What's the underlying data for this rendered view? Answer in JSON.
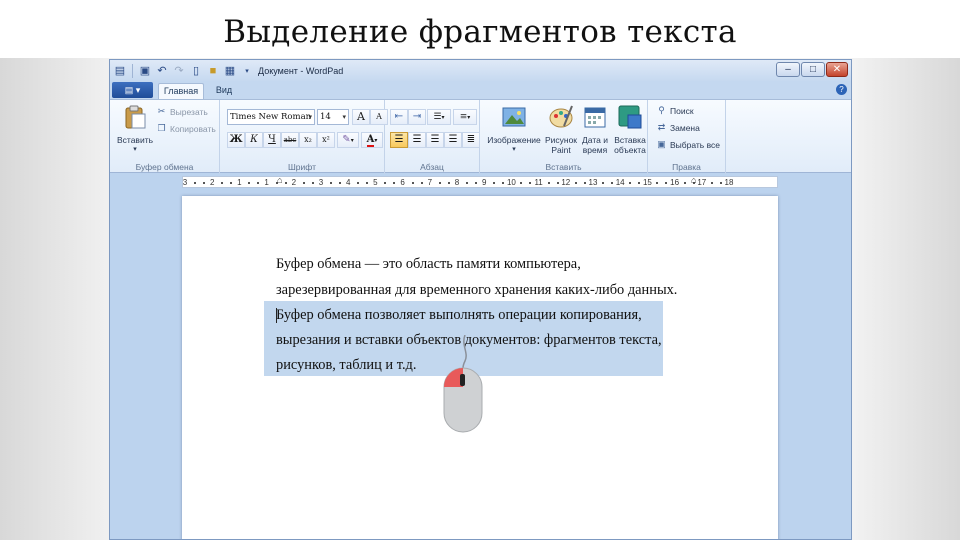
{
  "slide": {
    "title": "Выделение фрагментов текста"
  },
  "window": {
    "title": "Документ - WordPad",
    "controls": {
      "minimize": "–",
      "maximize": "□",
      "close": "✕"
    }
  },
  "tabs": {
    "app_menu": "▤ ▾",
    "home": "Главная",
    "view": "Вид",
    "help": "?"
  },
  "ribbon": {
    "clipboard": {
      "paste": "Вставить",
      "cut": "Вырезать",
      "copy": "Копировать",
      "label": "Буфер обмена"
    },
    "font": {
      "family": "Times New Roman",
      "size": "14",
      "bold": "Ж",
      "italic": "К",
      "underline": "Ч",
      "strike": "abc",
      "subscript": "x₂",
      "superscript": "x²",
      "grow": "A",
      "shrink": "A",
      "label": "Шрифт"
    },
    "paragraph": {
      "label": "Абзац"
    },
    "insert": {
      "image": "Изображение",
      "paint_1": "Рисунок",
      "paint_2": "Paint",
      "datetime_1": "Дата и",
      "datetime_2": "время",
      "object_1": "Вставка",
      "object_2": "объекта",
      "label": "Вставить"
    },
    "edit": {
      "find": "Поиск",
      "replace": "Замена",
      "select_all": "Выбрать все",
      "label": "Правка"
    }
  },
  "ruler": {
    "numbers": [
      "3",
      "2",
      "1",
      "1",
      "2",
      "3",
      "4",
      "5",
      "6",
      "7",
      "8",
      "9",
      "10",
      "11",
      "12",
      "13",
      "14",
      "15",
      "16",
      "17",
      "18"
    ]
  },
  "document": {
    "lines": [
      "Буфер обмена — это область памяти компьютера,",
      "зарезервированная для временного хранения каких-либо данных.",
      "Буфер обмена позволяет выполнять операции копирования,",
      "вырезания и вставки объектов документов: фрагментов текста,",
      "рисунков, таблиц и т.д."
    ]
  },
  "colors": {
    "selection": "#c2d7ee",
    "mouse_button": "#e85a5a",
    "ribbon_bg": "#e1ecf9"
  }
}
